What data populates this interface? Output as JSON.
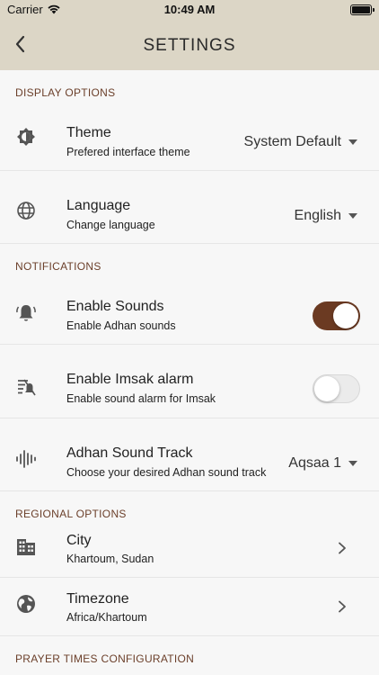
{
  "status_bar": {
    "carrier": "Carrier",
    "time": "10:49 AM"
  },
  "nav": {
    "title": "SETTINGS"
  },
  "sections": {
    "display": "DISPLAY OPTIONS",
    "notifications": "NOTIFICATIONS",
    "regional": "REGIONAL OPTIONS",
    "prayer": "PRAYER TIMES CONFIGURATION"
  },
  "theme": {
    "title": "Theme",
    "subtitle": "Prefered interface theme",
    "value": "System Default"
  },
  "language": {
    "title": "Language",
    "subtitle": "Change language",
    "value": "English"
  },
  "sounds": {
    "title": "Enable Sounds",
    "subtitle": "Enable Adhan sounds",
    "enabled": true
  },
  "imsak": {
    "title": "Enable Imsak alarm",
    "subtitle": "Enable sound alarm for Imsak",
    "enabled": false
  },
  "track": {
    "title": "Adhan Sound Track",
    "subtitle": "Choose your desired Adhan sound track",
    "value": "Aqsaa 1"
  },
  "city": {
    "title": "City",
    "subtitle": "Khartoum, Sudan"
  },
  "timezone": {
    "title": "Timezone",
    "subtitle": "Africa/Khartoum"
  },
  "colors": {
    "accent": "#6b3a22",
    "header_bg": "#dcd6c6",
    "section_text": "#6b3f2a"
  },
  "icons": [
    "back-chevron-icon",
    "theme-brightness-icon",
    "globe-icon",
    "bell-ringing-icon",
    "alarm-off-icon",
    "sound-wave-icon",
    "city-buildings-icon",
    "earth-icon",
    "chevron-right-icon"
  ]
}
